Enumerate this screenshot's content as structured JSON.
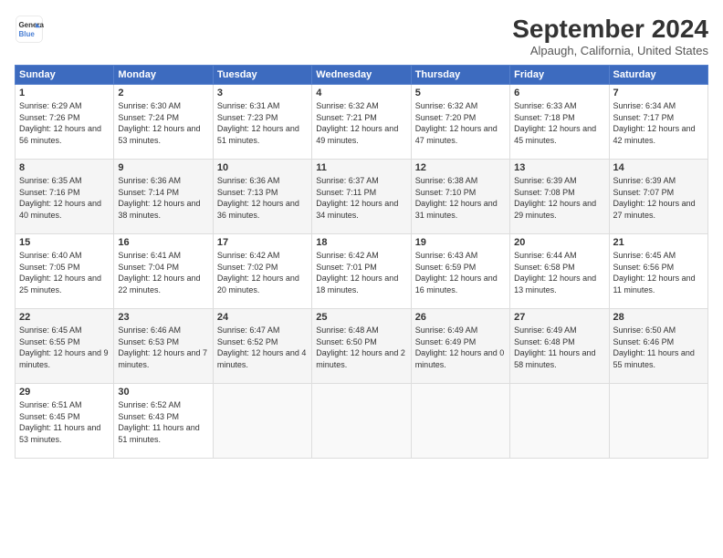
{
  "header": {
    "logo_line1": "General",
    "logo_line2": "Blue",
    "month_title": "September 2024",
    "location": "Alpaugh, California, United States"
  },
  "weekdays": [
    "Sunday",
    "Monday",
    "Tuesday",
    "Wednesday",
    "Thursday",
    "Friday",
    "Saturday"
  ],
  "weeks": [
    [
      {
        "day": "1",
        "sunrise": "6:29 AM",
        "sunset": "7:26 PM",
        "daylight": "12 hours and 56 minutes."
      },
      {
        "day": "2",
        "sunrise": "6:30 AM",
        "sunset": "7:24 PM",
        "daylight": "12 hours and 53 minutes."
      },
      {
        "day": "3",
        "sunrise": "6:31 AM",
        "sunset": "7:23 PM",
        "daylight": "12 hours and 51 minutes."
      },
      {
        "day": "4",
        "sunrise": "6:32 AM",
        "sunset": "7:21 PM",
        "daylight": "12 hours and 49 minutes."
      },
      {
        "day": "5",
        "sunrise": "6:32 AM",
        "sunset": "7:20 PM",
        "daylight": "12 hours and 47 minutes."
      },
      {
        "day": "6",
        "sunrise": "6:33 AM",
        "sunset": "7:18 PM",
        "daylight": "12 hours and 45 minutes."
      },
      {
        "day": "7",
        "sunrise": "6:34 AM",
        "sunset": "7:17 PM",
        "daylight": "12 hours and 42 minutes."
      }
    ],
    [
      {
        "day": "8",
        "sunrise": "6:35 AM",
        "sunset": "7:16 PM",
        "daylight": "12 hours and 40 minutes."
      },
      {
        "day": "9",
        "sunrise": "6:36 AM",
        "sunset": "7:14 PM",
        "daylight": "12 hours and 38 minutes."
      },
      {
        "day": "10",
        "sunrise": "6:36 AM",
        "sunset": "7:13 PM",
        "daylight": "12 hours and 36 minutes."
      },
      {
        "day": "11",
        "sunrise": "6:37 AM",
        "sunset": "7:11 PM",
        "daylight": "12 hours and 34 minutes."
      },
      {
        "day": "12",
        "sunrise": "6:38 AM",
        "sunset": "7:10 PM",
        "daylight": "12 hours and 31 minutes."
      },
      {
        "day": "13",
        "sunrise": "6:39 AM",
        "sunset": "7:08 PM",
        "daylight": "12 hours and 29 minutes."
      },
      {
        "day": "14",
        "sunrise": "6:39 AM",
        "sunset": "7:07 PM",
        "daylight": "12 hours and 27 minutes."
      }
    ],
    [
      {
        "day": "15",
        "sunrise": "6:40 AM",
        "sunset": "7:05 PM",
        "daylight": "12 hours and 25 minutes."
      },
      {
        "day": "16",
        "sunrise": "6:41 AM",
        "sunset": "7:04 PM",
        "daylight": "12 hours and 22 minutes."
      },
      {
        "day": "17",
        "sunrise": "6:42 AM",
        "sunset": "7:02 PM",
        "daylight": "12 hours and 20 minutes."
      },
      {
        "day": "18",
        "sunrise": "6:42 AM",
        "sunset": "7:01 PM",
        "daylight": "12 hours and 18 minutes."
      },
      {
        "day": "19",
        "sunrise": "6:43 AM",
        "sunset": "6:59 PM",
        "daylight": "12 hours and 16 minutes."
      },
      {
        "day": "20",
        "sunrise": "6:44 AM",
        "sunset": "6:58 PM",
        "daylight": "12 hours and 13 minutes."
      },
      {
        "day": "21",
        "sunrise": "6:45 AM",
        "sunset": "6:56 PM",
        "daylight": "12 hours and 11 minutes."
      }
    ],
    [
      {
        "day": "22",
        "sunrise": "6:45 AM",
        "sunset": "6:55 PM",
        "daylight": "12 hours and 9 minutes."
      },
      {
        "day": "23",
        "sunrise": "6:46 AM",
        "sunset": "6:53 PM",
        "daylight": "12 hours and 7 minutes."
      },
      {
        "day": "24",
        "sunrise": "6:47 AM",
        "sunset": "6:52 PM",
        "daylight": "12 hours and 4 minutes."
      },
      {
        "day": "25",
        "sunrise": "6:48 AM",
        "sunset": "6:50 PM",
        "daylight": "12 hours and 2 minutes."
      },
      {
        "day": "26",
        "sunrise": "6:49 AM",
        "sunset": "6:49 PM",
        "daylight": "12 hours and 0 minutes."
      },
      {
        "day": "27",
        "sunrise": "6:49 AM",
        "sunset": "6:48 PM",
        "daylight": "11 hours and 58 minutes."
      },
      {
        "day": "28",
        "sunrise": "6:50 AM",
        "sunset": "6:46 PM",
        "daylight": "11 hours and 55 minutes."
      }
    ],
    [
      {
        "day": "29",
        "sunrise": "6:51 AM",
        "sunset": "6:45 PM",
        "daylight": "11 hours and 53 minutes."
      },
      {
        "day": "30",
        "sunrise": "6:52 AM",
        "sunset": "6:43 PM",
        "daylight": "11 hours and 51 minutes."
      },
      null,
      null,
      null,
      null,
      null
    ]
  ]
}
